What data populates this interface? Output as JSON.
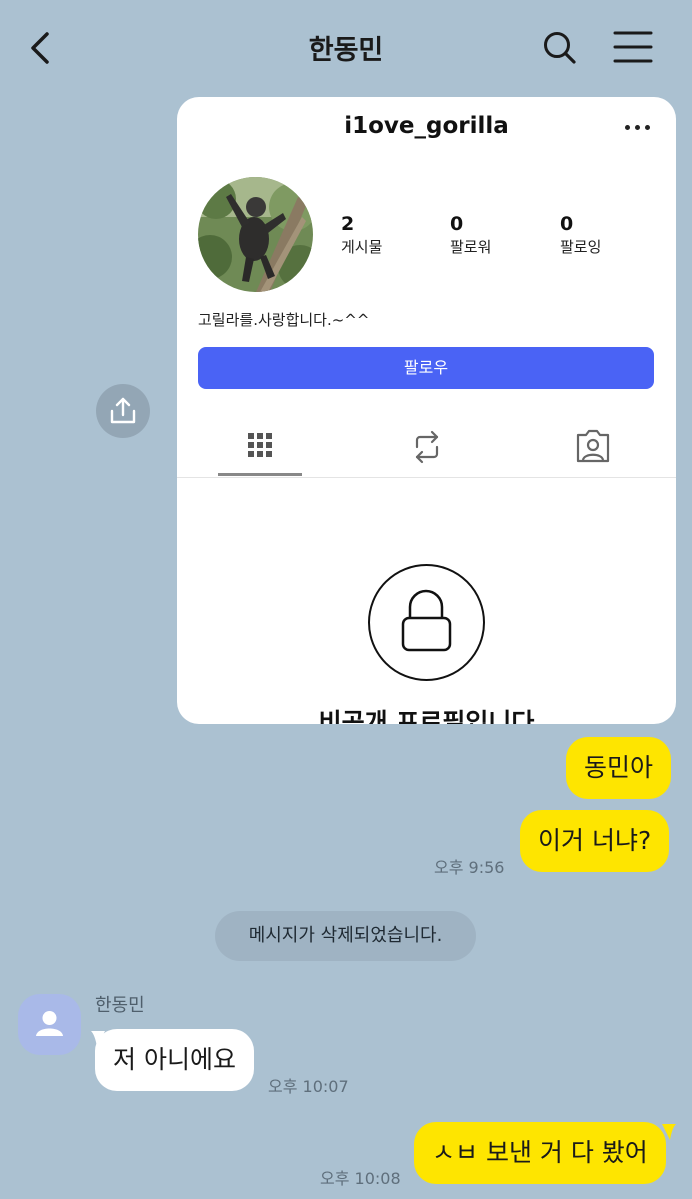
{
  "header": {
    "title": "한동민"
  },
  "shared_screenshot": {
    "username": "i1ove_gorilla",
    "stats": [
      {
        "value": "2",
        "label": "게시물"
      },
      {
        "value": "0",
        "label": "팔로워"
      },
      {
        "value": "0",
        "label": "팔로잉"
      }
    ],
    "bio": "고릴라를.사랑합니다.~^^",
    "follow_label": "팔로우",
    "private_text": "비공개 프로필입니다"
  },
  "messages": {
    "m1": "동민아",
    "m2": "이거 너냐?",
    "m2_time": "오후 9:56",
    "system": "메시지가 삭제되었습니다.",
    "sender_name": "한동민",
    "m3": "저 아니에요",
    "m3_time": "오후 10:07",
    "m4": "ㅅㅂ 보낸 거 다 봤어",
    "m4_time": "오후 10:08"
  },
  "colors": {
    "background": "#abc1d1",
    "my_bubble": "#fee500",
    "other_bubble": "#ffffff",
    "follow_button": "#4a63f5"
  }
}
